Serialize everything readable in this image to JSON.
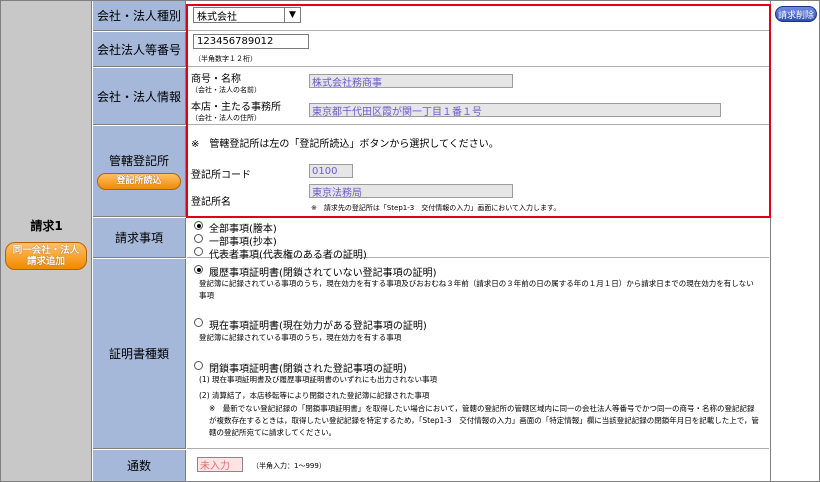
{
  "request": {
    "title": "請求1",
    "add_button": "同一会社・法人請求追加",
    "delete_button": "請求削除"
  },
  "company_type": {
    "label": "会社・法人種別",
    "selected": "株式会社"
  },
  "corp_number": {
    "label": "会社法人等番号",
    "value": "123456789012",
    "note": "（半角数字１２桁）"
  },
  "company_info": {
    "label": "会社・法人情報",
    "name_label": "商号・名称",
    "name_note": "（会社・法人の名前）",
    "name_value": "株式会社務商事",
    "address_label": "本店・主たる事務所",
    "address_note": "（会社・法人の住所）",
    "address_value": "東京都千代田区霞が関一丁目１番１号"
  },
  "registry": {
    "label": "管轄登記所",
    "button": "登記所読込",
    "instruction": "※　管轄登記所は左の「登記所読込」ボタンから選択してください。",
    "code_label": "登記所コード",
    "code_value": "0100",
    "name_label": "登記所名",
    "name_value": "東京法務局",
    "name_note": "※　請求先の登記所は「Step1-3　交付情報の入力」画面において入力します。"
  },
  "request_items": {
    "label": "請求事項",
    "options": [
      "全部事項(謄本)",
      "一部事項(抄本)",
      "代表者事項(代表権のある者の証明)"
    ],
    "selected_index": 0
  },
  "certificate_type": {
    "label": "証明書種類",
    "selected_index": 0,
    "options": [
      {
        "title": "履歴事項証明書(閉鎖されていない登記事項の証明)",
        "desc": "登記簿に記録されている事項のうち，現在効力を有する事項及びおおむね３年前（請求日の３年前の日の属する年の１月１日）から請求日までの現在効力を有しない事項"
      },
      {
        "title": "現在事項証明書(現在効力がある登記事項の証明)",
        "desc": "登記簿に記録されている事項のうち，現在効力を有する事項"
      },
      {
        "title": "閉鎖事項証明書(閉鎖された登記事項の証明)",
        "desc1": "(1) 現在事項証明書及び履歴事項証明書のいずれにも出力されない事項",
        "desc2": "(2) 清算結了，本店移転等により閉鎖された登記簿に記録された事項",
        "desc3": "※　最新でない登記記録の「閉鎖事項証明書」を取得したい場合において，管轄の登記所の管轄区域内に同一の会社法人等番号でかつ同一の商号・名称の登記記録が複数存在するときは，取得したい登記記録を特定するため，「Step1-3　交付情報の入力」画面の「特定情報」欄に当該登記記録の閉鎖年月日を記載した上で，管轄の登記所宛てに請求してください。"
      }
    ]
  },
  "copies": {
    "label": "通数",
    "placeholder": "未入力",
    "note": "（半角入力：1～999）"
  }
}
